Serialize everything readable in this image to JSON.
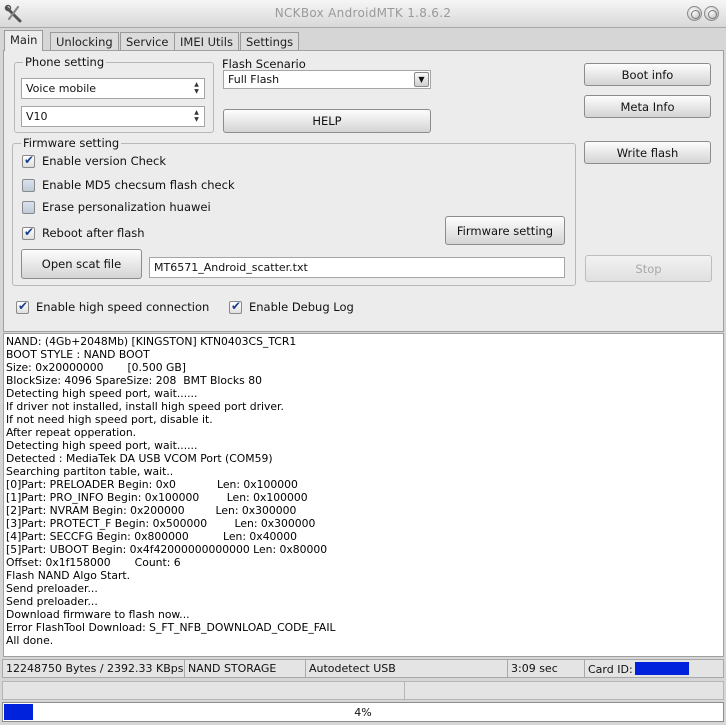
{
  "window": {
    "title": "NCKBox AndroidMTK 1.8.6.2"
  },
  "tabs": [
    {
      "label": "Main"
    },
    {
      "label": "Unlocking"
    },
    {
      "label": "Service"
    },
    {
      "label": "IMEI Utils"
    },
    {
      "label": "Settings"
    }
  ],
  "phone_setting": {
    "label": "Phone setting",
    "type_value": "Voice mobile",
    "model_value": "V10"
  },
  "flash_scenario": {
    "label": "Flash Scenario",
    "value": "Full Flash"
  },
  "buttons": {
    "help": "HELP",
    "boot_info": "Boot info",
    "meta_info": "Meta Info",
    "write_flash": "Write flash",
    "firmware_setting": "Firmware setting",
    "open_scat_file": "Open scat file",
    "stop": "Stop"
  },
  "firmware_setting": {
    "label": "Firmware setting",
    "options": [
      {
        "label": "Enable version Check",
        "checked": true
      },
      {
        "label": "Enable MD5 checsum flash check",
        "checked": false
      },
      {
        "label": "Erase personalization huawei",
        "checked": false
      },
      {
        "label": "Reboot after flash",
        "checked": true
      }
    ],
    "scatter_file": "MT6571_Android_scatter.txt"
  },
  "connection": {
    "high_speed": {
      "label": "Enable high speed connection",
      "checked": true
    },
    "debug_log": {
      "label": "Enable Debug Log",
      "checked": true
    }
  },
  "log_lines": [
    "NAND: (4Gb+2048Mb) [KINGSTON] KTN0403CS_TCR1",
    "BOOT STYLE : NAND BOOT",
    "Size: 0x20000000       [0.500 GB]",
    "BlockSize: 4096 SpareSize: 208  BMT Blocks 80",
    "Detecting high speed port, wait......",
    "If driver not installed, install high speed port driver.",
    "If not need high speed port, disable it.",
    "After repeat opperation.",
    "Detecting high speed port, wait......",
    "Detected : MediaTek DA USB VCOM Port (COM59)",
    "Searching partiton table, wait..",
    "[0]Part: PRELOADER Begin: 0x0            Len: 0x100000",
    "[1]Part: PRO_INFO Begin: 0x100000        Len: 0x100000",
    "[2]Part: NVRAM Begin: 0x200000         Len: 0x300000",
    "[3]Part: PROTECT_F Begin: 0x500000        Len: 0x300000",
    "[4]Part: SECCFG Begin: 0x800000          Len: 0x40000",
    "[5]Part: UBOOT Begin: 0x4f42000000000000 Len: 0x80000",
    "Offset: 0x1f158000       Count: 6",
    "Flash NAND Algo Start.",
    "Send preloader...",
    "Send preloader...",
    "Download firmware to flash now...",
    "Error FlashTool Download: S_FT_NFB_DOWNLOAD_CODE_FAIL",
    "All done."
  ],
  "status": {
    "bytes": "12248750 Bytes / 2392.33 KBps",
    "storage": "NAND STORAGE",
    "port": "Autodetect USB",
    "time": "3:09 sec",
    "card_id_label": "Card ID:"
  },
  "progress": {
    "percent_label": "4%",
    "fraction": 0.04
  },
  "colors": {
    "accent": "#0022dd"
  },
  "icons": {
    "app": "wrench-screwdriver-icon"
  }
}
